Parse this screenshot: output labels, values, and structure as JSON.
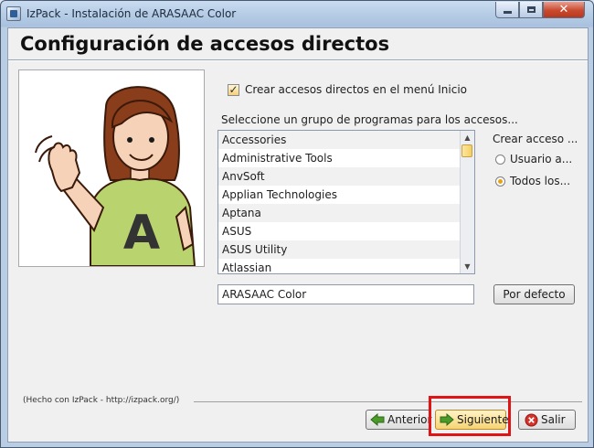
{
  "window": {
    "title": "IzPack - Instalación de ARASAAC Color",
    "close_symbol": "✕"
  },
  "page": {
    "title": "Configuración de accesos directos"
  },
  "picture": {
    "subject": "ARASAAC pictogram girl waving",
    "shirt_letter": "A"
  },
  "shortcuts": {
    "create_in_start_menu_label": "Crear accesos directos en el menú Inicio",
    "create_in_start_menu_checked": true,
    "checkmark": "✓",
    "group_prompt": "Seleccione un grupo de programas para los accesos...",
    "groups": [
      "Accessories",
      "Administrative Tools",
      "AnvSoft",
      "Applian Technologies",
      "Aptana",
      "ASUS",
      "ASUS Utility",
      "Atlassian"
    ],
    "scroll_up": "▲",
    "scroll_down": "▼",
    "program_group_value": "ARASAAC Color",
    "default_button_label": "Por defecto",
    "create_for_label": "Crear acceso ...",
    "create_for_options": [
      {
        "label": "Usuario a...",
        "checked": false
      },
      {
        "label": "Todos los...",
        "checked": true
      }
    ]
  },
  "footer": {
    "credit": "(Hecho con IzPack - http://izpack.org/)",
    "previous_label": "Anterior",
    "next_label": "Siguiente",
    "exit_label": "Salir"
  },
  "colors": {
    "accent": "#f6d474",
    "highlight_box": "#e01414"
  }
}
